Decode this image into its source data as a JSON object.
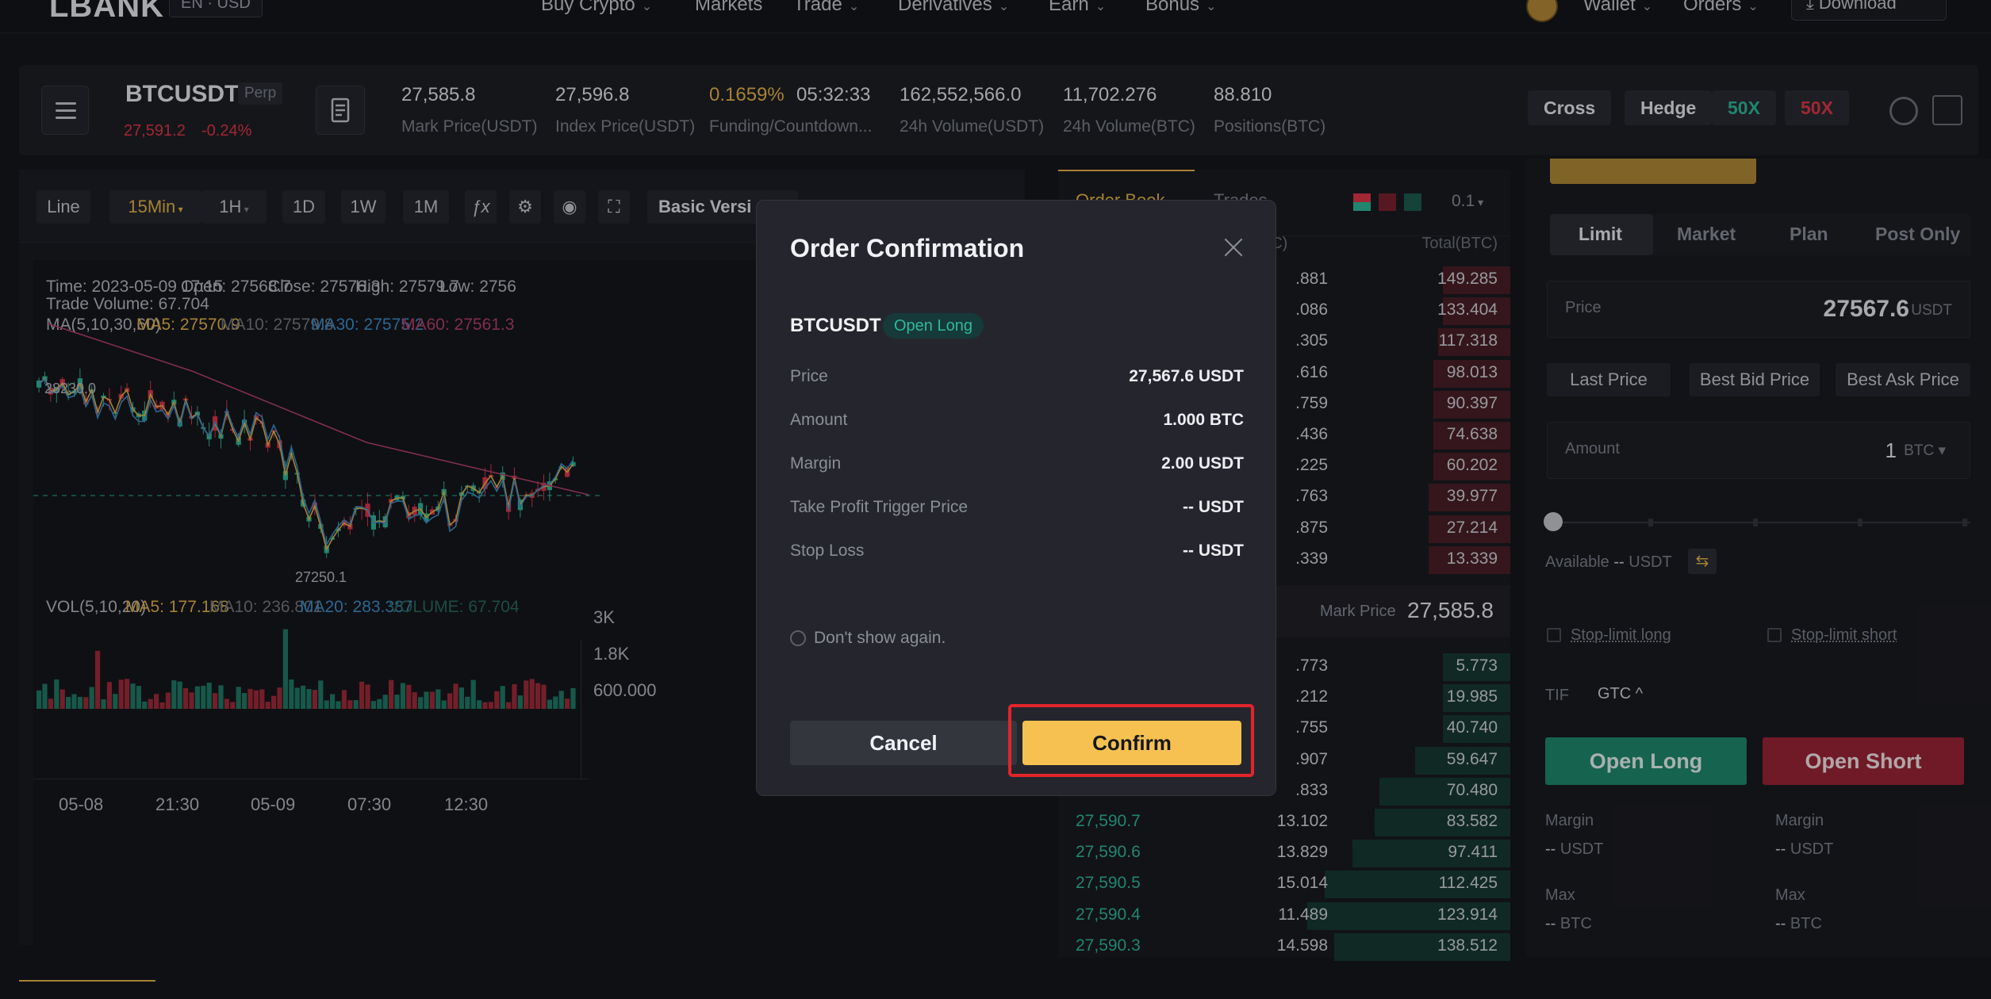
{
  "nav": {
    "logo": "LBANK",
    "lang": "EN · USD",
    "items": [
      {
        "label": "Buy Crypto",
        "chev": true
      },
      {
        "label": "Markets",
        "chev": false
      },
      {
        "label": "Trade",
        "chev": true
      },
      {
        "label": "Derivatives",
        "chev": true
      },
      {
        "label": "Earn",
        "chev": true
      },
      {
        "label": "Bonus",
        "chev": true
      }
    ],
    "wallet": "Wallet",
    "orders": "Orders",
    "download": "Download"
  },
  "ticker": {
    "symbol": "BTCUSDT",
    "type": "Perp",
    "last_price": "27,591.2",
    "change": "-0.24%",
    "stats": [
      {
        "value": "27,585.8",
        "label": "Mark Price(USDT)"
      },
      {
        "value": "27,596.8",
        "label": "Index Price(USDT)"
      },
      {
        "value": "0.1659%",
        "value2": "05:32:33",
        "label": "Funding/Countdown..."
      },
      {
        "value": "162,552,566.0",
        "label": "24h Volume(USDT)"
      },
      {
        "value": "11,702.276",
        "label": "24h Volume(BTC)"
      },
      {
        "value": "88.810",
        "label": "Positions(BTC)"
      }
    ],
    "modes": {
      "cross": "Cross",
      "hedge": "Hedge",
      "long_lev": "50X",
      "short_lev": "50X"
    }
  },
  "toolbar": {
    "line": "Line",
    "interval": "15Min",
    "h1": "1H",
    "d1": "1D",
    "w1": "1W",
    "m1": "1M",
    "fx": "ƒx",
    "version": "Basic Versi"
  },
  "chart_info": {
    "time": "Time: 2023-05-09 17:15",
    "open": "Open: 27568.7",
    "close": "Close: 27576.3",
    "high": "High: 27579.7",
    "low": "Low: 2756",
    "trade_volume": "Trade Volume: 67.704",
    "ma_label": "MA(5,10,30,60)",
    "ma5": "MA5: 27570.9",
    "ma10": "MA10: 27579.8",
    "ma30": "MA30: 27575.2",
    "ma60": "MA60: 27561.3",
    "high_mark": "28230.0",
    "low_mark": "27250.1",
    "vol_label": "VOL(5,10,20)",
    "vol_ma5": "MA5: 177.168",
    "vol_ma10": "MA10: 236.801",
    "vol_ma20": "MA20: 283.387",
    "vol_volume": "VOLUME: 67.704",
    "vol_ticks": [
      "3K",
      "1.8K",
      "600.000"
    ],
    "x_ticks": [
      "05-08",
      "21:30",
      "05-09",
      "07:30",
      "12:30"
    ]
  },
  "orderbook": {
    "tab_book": "Order Book",
    "tab_trades": "Trades",
    "precision": "0.1",
    "col_amount": "(BTC)",
    "col_total": "Total(BTC)",
    "asks": [
      {
        "amt": ".881",
        "total": "149.285",
        "fill": 0.15
      },
      {
        "amt": ".086",
        "total": "133.404",
        "fill": 0.15
      },
      {
        "amt": ".305",
        "total": "117.318",
        "fill": 0.16
      },
      {
        "amt": ".616",
        "total": "98.013",
        "fill": 0.17
      },
      {
        "amt": ".759",
        "total": "90.397",
        "fill": 0.17
      },
      {
        "amt": ".436",
        "total": "74.638",
        "fill": 0.17
      },
      {
        "amt": ".225",
        "total": "60.202",
        "fill": 0.17
      },
      {
        "amt": ".763",
        "total": "39.977",
        "fill": 0.18
      },
      {
        "amt": ".875",
        "total": "27.214",
        "fill": 0.18
      },
      {
        "amt": ".339",
        "total": "13.339",
        "fill": 0.18
      }
    ],
    "mark_label": "Mark Price",
    "mark_value": "27,585.8",
    "bids": [
      {
        "price": "",
        "amt": ".773",
        "total": "5.773",
        "fill": 0.15
      },
      {
        "price": "",
        "amt": ".212",
        "total": "19.985",
        "fill": 0.15
      },
      {
        "price": "",
        "amt": ".755",
        "total": "40.740",
        "fill": 0.15
      },
      {
        "price": "",
        "amt": ".907",
        "total": "59.647",
        "fill": 0.21
      },
      {
        "price": "",
        "amt": ".833",
        "total": "70.480",
        "fill": 0.29
      },
      {
        "price": "27,590.7",
        "amt": "13.102",
        "total": "83.582",
        "fill": 0.3
      },
      {
        "price": "27,590.6",
        "amt": "13.829",
        "total": "97.411",
        "fill": 0.35
      },
      {
        "price": "27,590.5",
        "amt": "15.014",
        "total": "112.425",
        "fill": 0.41
      },
      {
        "price": "27,590.4",
        "amt": "11.489",
        "total": "123.914",
        "fill": 0.45
      },
      {
        "price": "27,590.3",
        "amt": "14.598",
        "total": "138.512",
        "fill": 0.39
      }
    ]
  },
  "order_form": {
    "tabs": [
      "Limit",
      "Market",
      "Plan",
      "Post Only"
    ],
    "price_label": "Price",
    "price_value": "27567.6",
    "price_unit": "USDT",
    "quick": [
      "Last Price",
      "Best Bid Price",
      "Best Ask Price"
    ],
    "amount_label": "Amount",
    "amount_value": "1",
    "amount_unit": "BTC",
    "available_label": "Available",
    "available_value": "--",
    "available_unit": "USDT",
    "stop_long": "Stop-limit long",
    "stop_short": "Stop-limit short",
    "tif_label": "TIF",
    "tif_value": "GTC",
    "open_long": "Open Long",
    "open_short": "Open Short",
    "margin_label": "Margin",
    "margin_value": "--",
    "margin_unit": "USDT",
    "max_label": "Max",
    "max_value": "--",
    "max_unit": "BTC"
  },
  "modal": {
    "title": "Order Confirmation",
    "symbol": "BTCUSDT",
    "side": "Open Long",
    "rows": [
      {
        "key": "Price",
        "value": "27,567.6 USDT"
      },
      {
        "key": "Amount",
        "value": "1.000 BTC"
      },
      {
        "key": "Margin",
        "value": "2.00 USDT"
      },
      {
        "key": "Take Profit Trigger Price",
        "value": "-- USDT"
      },
      {
        "key": "Stop Loss",
        "value": "-- USDT"
      }
    ],
    "dont_show": "Don't show again.",
    "cancel": "Cancel",
    "confirm": "Confirm"
  },
  "colors": {
    "accent": "#f6c150",
    "up": "#2fb99a",
    "down": "#e0364a",
    "highlight": "#e3242b"
  }
}
